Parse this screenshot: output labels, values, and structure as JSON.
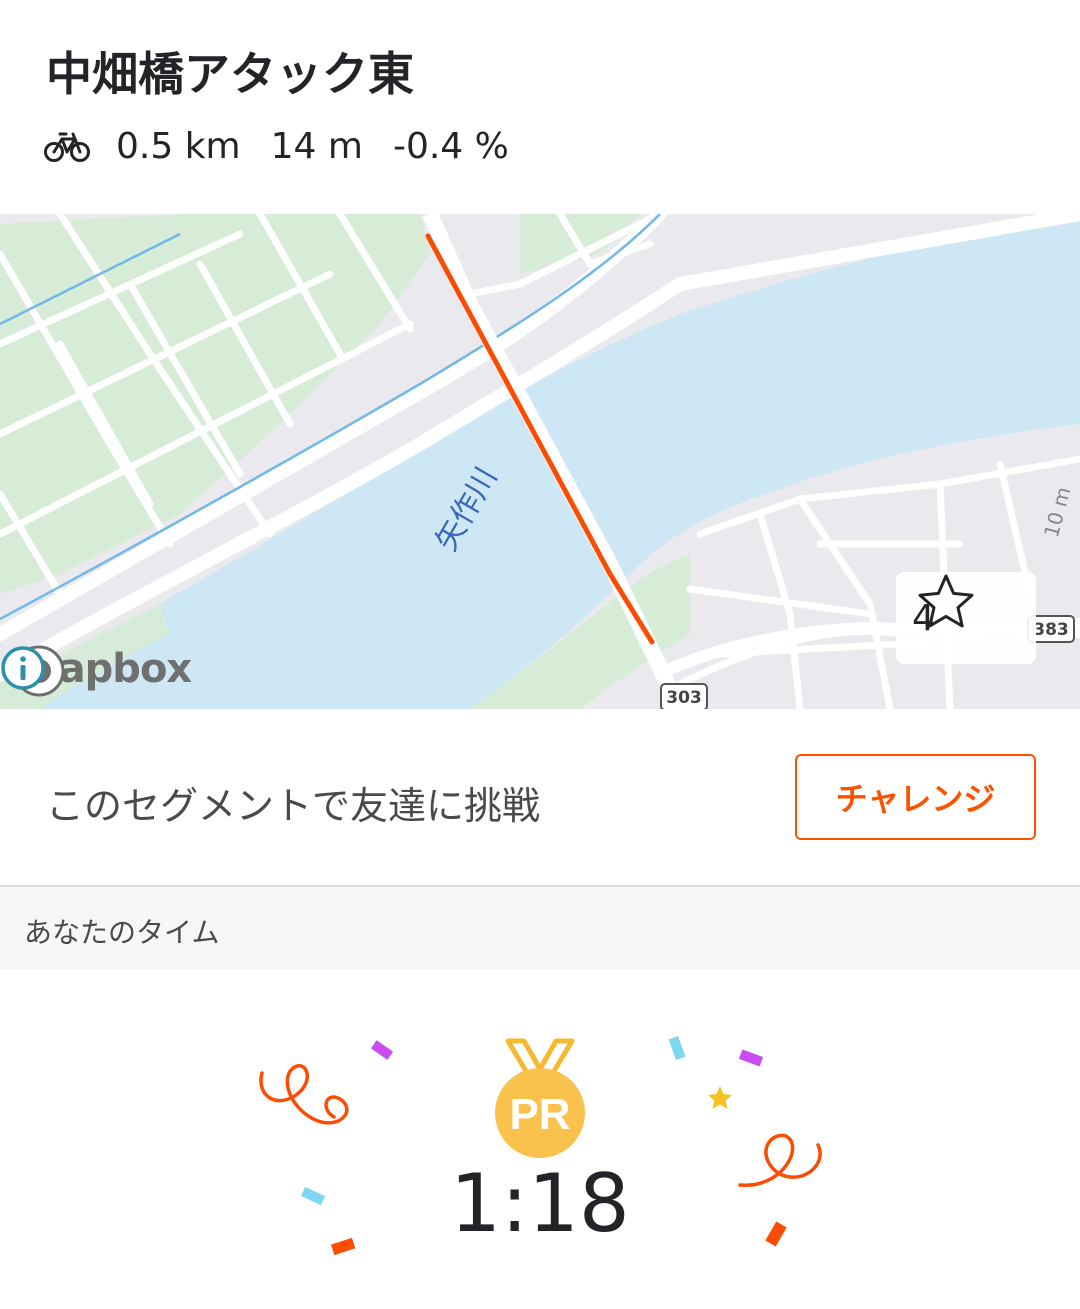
{
  "segment": {
    "title": "中畑橋アタック東",
    "activity_icon": "bike-icon",
    "distance": "0.5 km",
    "elevation": "14 m",
    "grade": "-0.4 %"
  },
  "map": {
    "river_label": "矢作川",
    "road_shield_1": "303",
    "road_shield_2": "383",
    "contour_label": "10 m",
    "star_count": "4",
    "attribution": "mapbox",
    "route_color": "#fc4c02",
    "water_color": "#cde8f4",
    "park_color": "#d7ecd6"
  },
  "challenge": {
    "text": "このセグメントで友達に挑戦",
    "button_label": "チャレンジ",
    "accent_color": "#fc5200"
  },
  "your_time": {
    "section_label": "あなたのタイム",
    "badge": "PR",
    "time": "1:18",
    "badge_color": "#f9c24d"
  }
}
